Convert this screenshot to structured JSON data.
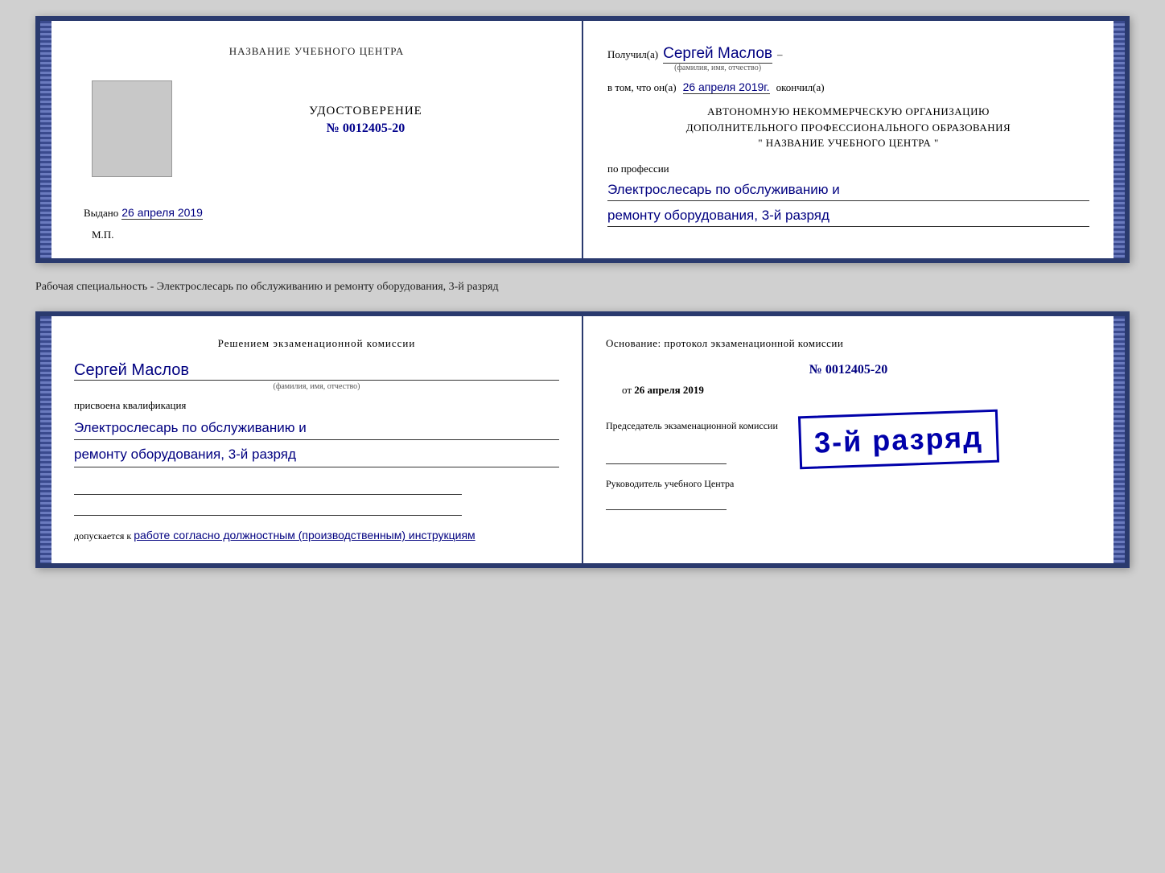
{
  "top_cert": {
    "left": {
      "org_name": "НАЗВАНИЕ УЧЕБНОГО ЦЕНТРА",
      "udost_label": "УДОСТОВЕРЕНИЕ",
      "udost_num": "№ 0012405-20",
      "issued_prefix": "Выдано",
      "issued_date": "26 апреля 2019",
      "mp": "М.П."
    },
    "right": {
      "received_prefix": "Получил(а)",
      "recipient_name": "Сергей Маслов",
      "fio_label": "(фамилия, имя, отчество)",
      "that_prefix": "в том, что он(а)",
      "that_date": "26 апреля 2019г.",
      "that_suffix": "окончил(а)",
      "org_line1": "АВТОНОМНУЮ НЕКОММЕРЧЕСКУЮ ОРГАНИЗАЦИЮ",
      "org_line2": "ДОПОЛНИТЕЛЬНОГО ПРОФЕССИОНАЛЬНОГО ОБРАЗОВАНИЯ",
      "org_quote": "\" НАЗВАНИЕ УЧЕБНОГО ЦЕНТРА \"",
      "profession_prefix": "по профессии",
      "profession_hw1": "Электрослесарь по обслуживанию и",
      "profession_hw2": "ремонту оборудования, 3-й разряд"
    }
  },
  "between_label": "Рабочая специальность - Электрослесарь по обслуживанию и ремонту оборудования, 3-й разряд",
  "bottom_cert": {
    "left": {
      "commission_title": "Решением экзаменационной комиссии",
      "person_name": "Сергей Маслов",
      "fio_label": "(фамилия, имя, отчество)",
      "assigned_label": "присвоена квалификация",
      "qual_hw1": "Электрослесарь по обслуживанию и",
      "qual_hw2": "ремонту оборудования, 3-й разряд",
      "dopusk_prefix": "допускается к",
      "dopusk_hw": "работе согласно должностным (производственным) инструкциям"
    },
    "right": {
      "osnov_label": "Основание: протокол экзаменационной комиссии",
      "protocol_num": "№ 0012405-20",
      "date_prefix": "от",
      "date_val": "26 апреля 2019",
      "stamp_line1": "3-й разряд",
      "stamp_big": "3-й разряд",
      "chairman_label": "Председатель экзаменационной комиссии",
      "rukov_label": "Руководитель учебного Центра"
    }
  }
}
